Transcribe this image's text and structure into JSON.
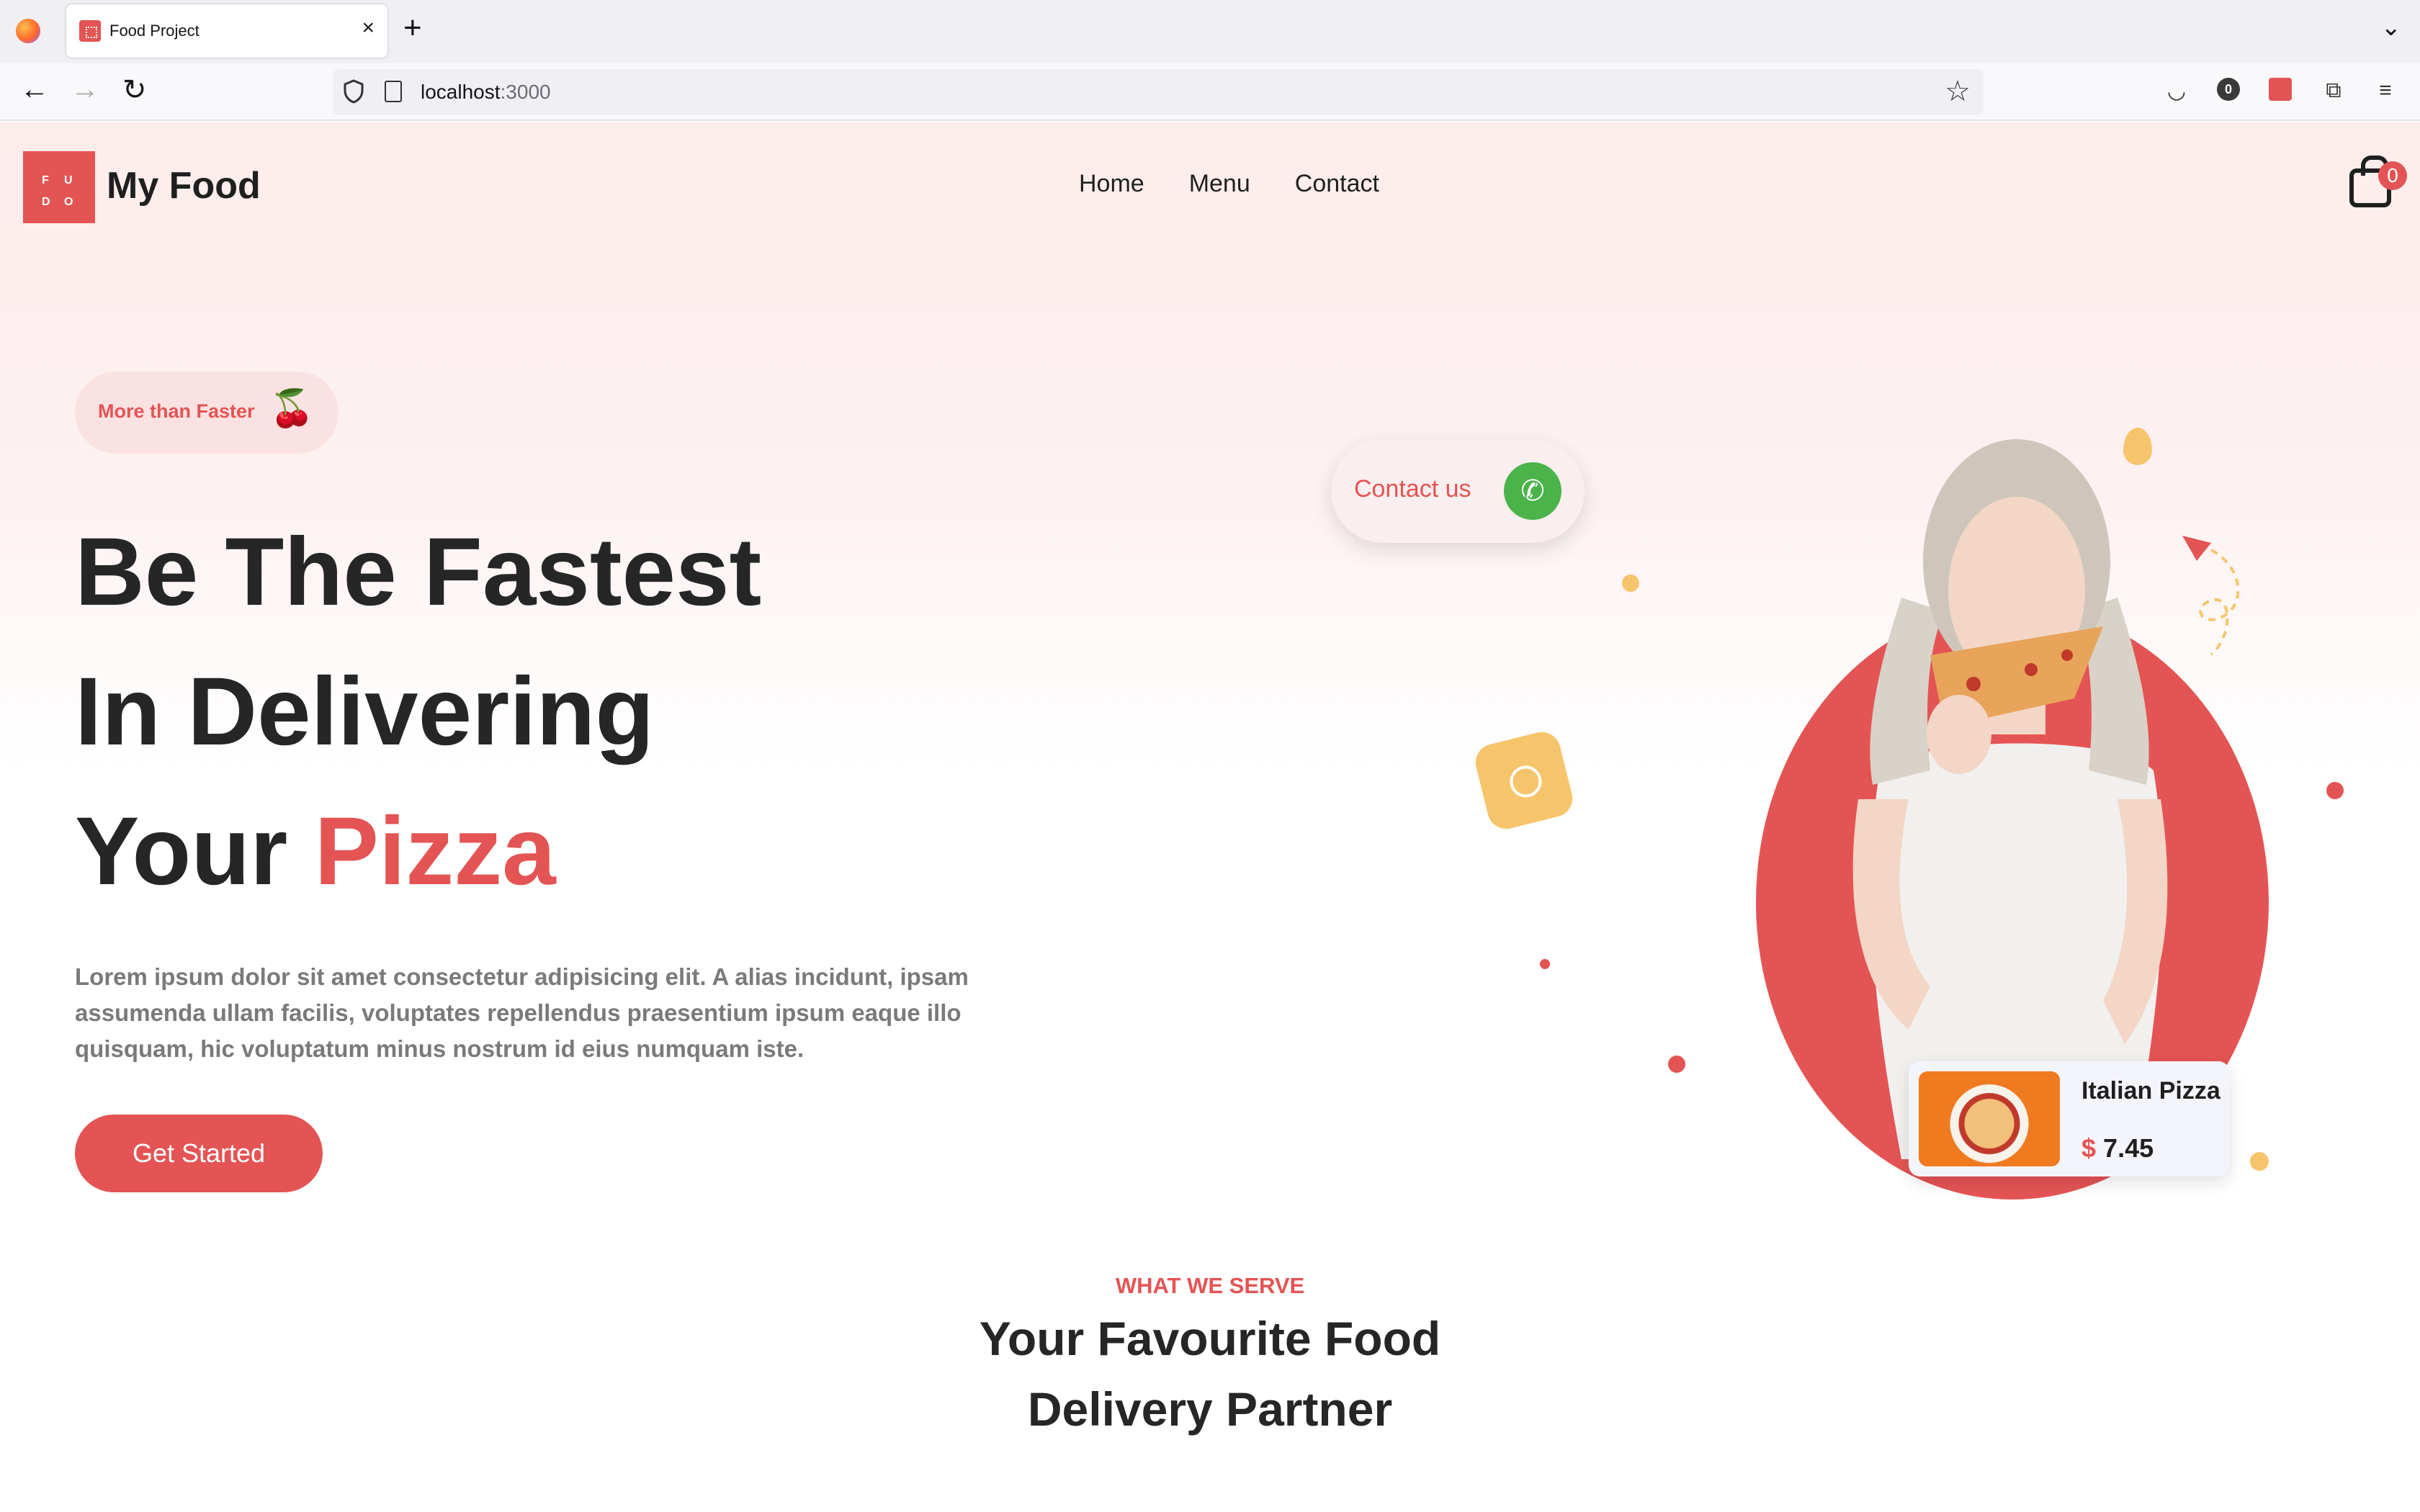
{
  "browser": {
    "tab_title": "Food Project",
    "url_host": "localhost",
    "url_port": ":3000",
    "toolbar_badge": "0"
  },
  "header": {
    "logo_letters": [
      "F",
      "U",
      "D",
      "O"
    ],
    "brand": "My Food",
    "nav": [
      "Home",
      "Menu",
      "Contact"
    ],
    "cart_count": "0"
  },
  "hero": {
    "pill": "More than Faster",
    "headline": [
      "Be The Fastest",
      "In Delivering",
      "Your"
    ],
    "headline_highlight": "Pizza",
    "body": "Lorem ipsum dolor sit amet consectetur adipisicing elit. A alias incidunt, ipsam assumenda ullam facilis, voluptates repellendus praesentium ipsum eaque illo quisquam, hic voluptatum minus nostrum id eius numquam iste.",
    "cta": "Get Started",
    "contact": "Contact us",
    "card_title": "Italian Pizza",
    "card_currency": "$",
    "card_price": "7.45"
  },
  "section": {
    "eyebrow": "WHAT WE SERVE",
    "title_line1": "Your Favourite Food",
    "title_line2": "Delivery Partner"
  },
  "colors": {
    "accent": "#e45454",
    "dark": "#262626",
    "yellow": "#f6c56b",
    "green": "#4ab34a"
  }
}
